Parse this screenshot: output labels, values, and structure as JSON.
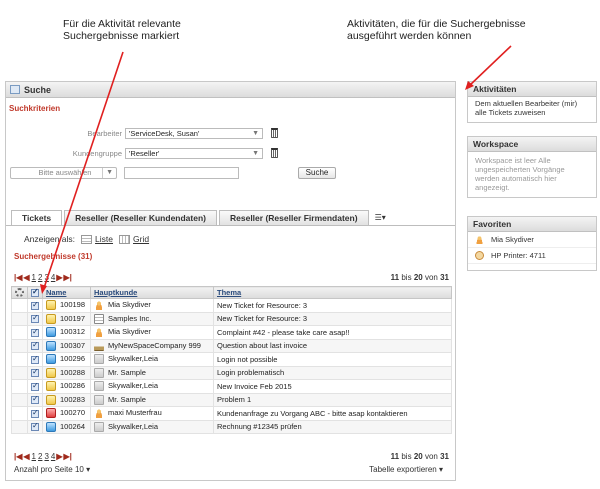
{
  "annotations": {
    "left": [
      "Für die Aktivität relevante",
      "Suchergebnisse markiert"
    ],
    "right": [
      "Aktivitäten, die für die Suchergebnisse",
      "ausgeführt werden können"
    ]
  },
  "search_panel": {
    "title": "Suche",
    "criteria_title": "Suchkriterien",
    "bearbeiter_label": "Bearbeiter",
    "bearbeiter_value": "'ServiceDesk, Susan'",
    "kundengruppe_label": "Kundengruppe",
    "kundengruppe_value": "'Reseller'",
    "select_placeholder": "Bitte auswählen",
    "search_button": "Suche"
  },
  "tabs": [
    "Tickets",
    "Reseller (Reseller Kundendaten)",
    "Reseller (Reseller Firmendaten)"
  ],
  "view": {
    "label": "Anzeigen als:",
    "list": "Liste",
    "grid": "Grid"
  },
  "results": {
    "title": "Suchergebnisse (31)",
    "pages": [
      "1",
      "2",
      "3",
      "4"
    ],
    "range_from": "11",
    "range_to": "20",
    "range_word_bis": "bis",
    "range_word_von": "von",
    "range_total": "31",
    "columns": [
      "Name",
      "Hauptkunde",
      "Thema"
    ],
    "rows": [
      {
        "name": "100198",
        "icon": "yellow",
        "kunde": "Mia Skydiver",
        "kunde_icon": "person",
        "thema": "New Ticket for Resource: 3"
      },
      {
        "name": "100197",
        "icon": "yellow",
        "kunde": "Samples Inc.",
        "kunde_icon": "company",
        "thema": "New Ticket for Resource: 3"
      },
      {
        "name": "100312",
        "icon": "blue",
        "kunde": "Mia Skydiver",
        "kunde_icon": "person",
        "thema": "Complaint #42 - please take care asap!!"
      },
      {
        "name": "100307",
        "icon": "blue",
        "kunde": "MyNewSpaceCompany 999",
        "kunde_icon": "building",
        "thema": "Question about last invoice"
      },
      {
        "name": "100296",
        "icon": "blue",
        "kunde": "Skywalker,Leia",
        "kunde_icon": "group",
        "thema": "Login not possible"
      },
      {
        "name": "100288",
        "icon": "yellow",
        "kunde": "Mr. Sample",
        "kunde_icon": "group",
        "thema": "Login problematisch"
      },
      {
        "name": "100286",
        "icon": "yellow",
        "kunde": "Skywalker,Leia",
        "kunde_icon": "group",
        "thema": "New Invoice Feb 2015"
      },
      {
        "name": "100283",
        "icon": "yellow",
        "kunde": "Mr. Sample",
        "kunde_icon": "group",
        "thema": "Problem 1"
      },
      {
        "name": "100270",
        "icon": "red",
        "kunde": "maxi Musterfrau",
        "kunde_icon": "person",
        "thema": "Kundenanfrage zu Vorgang ABC - bitte asap kontaktieren"
      },
      {
        "name": "100264",
        "icon": "blue",
        "kunde": "Skywalker,Leia",
        "kunde_icon": "group",
        "thema": "Rechnung #12345 prüfen"
      }
    ],
    "page_size_label": "Anzahl pro Seite",
    "page_size_value": "10",
    "export_label": "Tabelle exportieren"
  },
  "activities": {
    "title": "Aktivitäten",
    "text": "Dem aktuellen Bearbeiter (mir) alle Tickets zuweisen"
  },
  "workspace": {
    "title": "Workspace",
    "text": "Workspace ist leer Alle ungespeicherten Vorgänge werden automatisch hier angezeigt."
  },
  "favorites": {
    "title": "Favoriten",
    "items": [
      {
        "label": "Mia Skydiver",
        "icon": "person"
      },
      {
        "label": "HP Printer: 4711",
        "icon": "printer"
      }
    ]
  },
  "colors": {
    "accent_red": "#c0392b",
    "link_blue": "#2a4b7c",
    "annotation_arrow": "#e02020"
  }
}
